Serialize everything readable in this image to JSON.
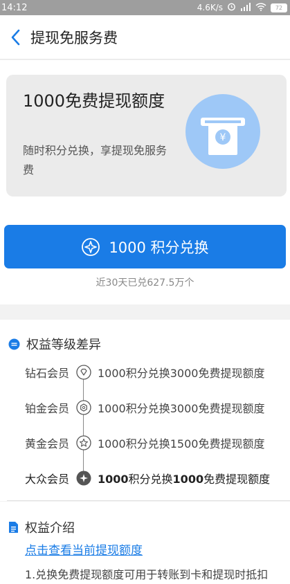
{
  "status": {
    "time": "14:12",
    "speed": "4.6K/s",
    "battery": "72"
  },
  "nav": {
    "title": "提现免服务费"
  },
  "banner": {
    "title": "1000免费提现额度",
    "subtitle": "随时积分兑换，享提现免服务费",
    "icon": "yen-card-icon"
  },
  "exchange": {
    "button_label": "1000 积分兑换",
    "note": "近30天已兑627.5万个"
  },
  "tiers": {
    "heading": "权益等级差异",
    "items": [
      {
        "name": "钻石会员",
        "desc": "1000积分兑换3000免费提现额度",
        "icon": "diamond-icon"
      },
      {
        "name": "铂金会员",
        "desc": "1000积分兑换3000免费提现额度",
        "icon": "hexagon-icon"
      },
      {
        "name": "黄金会员",
        "desc": "1000积分兑换1500免费提现额度",
        "icon": "star-icon"
      },
      {
        "name": "大众会员",
        "desc_parts": [
          "1000",
          "积分兑换",
          "1000",
          "免费提现额度"
        ],
        "icon": "sparkle-icon"
      }
    ]
  },
  "intro": {
    "heading": "权益介绍",
    "link": "点击查看当前提现额度",
    "para1": "1.兑换免费提现额度可用于转账到卡和提现时抵扣"
  },
  "colors": {
    "accent": "#1a7ce6",
    "banner_circle": "#9ec8f7"
  }
}
